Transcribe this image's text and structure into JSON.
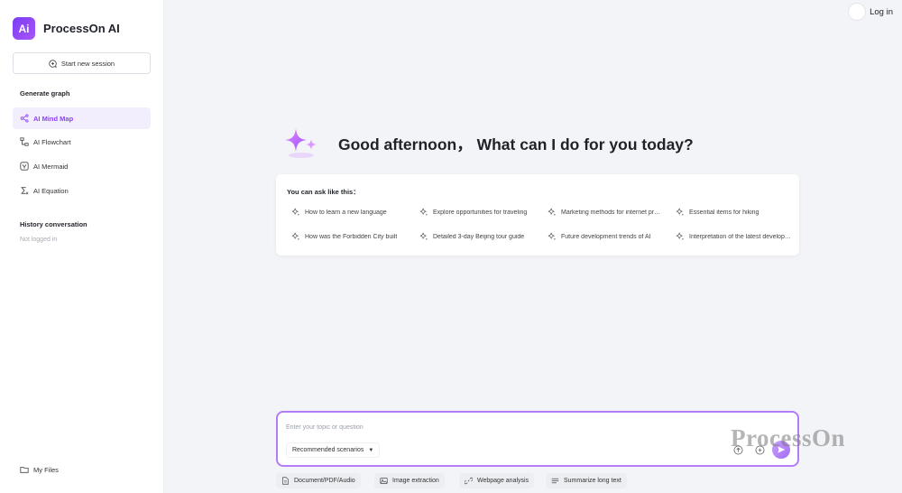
{
  "brand": {
    "name": "ProcessOn AI",
    "logo_text": "Ai",
    "accent": "#8a3ffc"
  },
  "sidebar": {
    "new_session": "Start new session",
    "generate_title": "Generate graph",
    "items": [
      {
        "label": "AI Mind Map",
        "icon": "mindmap-icon",
        "active": true
      },
      {
        "label": "AI Flowchart",
        "icon": "flowchart-icon",
        "active": false
      },
      {
        "label": "AI Mermaid",
        "icon": "mermaid-icon",
        "active": false
      },
      {
        "label": "AI Equation",
        "icon": "sigma-icon",
        "active": false
      }
    ],
    "history_title": "History conversation",
    "history_status": "Not logged in",
    "my_files": "My Files"
  },
  "header": {
    "login": "Log in"
  },
  "hero": {
    "greeting": "Good afternoon， What can I do for you today?"
  },
  "suggestions": {
    "title": "You can ask like this：",
    "items": [
      "How to learn a new language",
      "Explore opportunities for traveling",
      "Marketing methods for internet products",
      "Essential items for hiking",
      "How was the Forbidden City built",
      "Detailed 3-day Beijing tour guide",
      "Future development trends of AI",
      "Interpretation of the latest development"
    ]
  },
  "composer": {
    "placeholder": "Enter your topic or question",
    "scenario": "Recommended scenarios",
    "watermark": "ProcessOn"
  },
  "quick_actions": [
    {
      "label": "Document/PDF/Audio",
      "icon": "document-icon"
    },
    {
      "label": "Image extraction",
      "icon": "image-icon"
    },
    {
      "label": "Webpage analysis",
      "icon": "link-icon"
    },
    {
      "label": "Summarize long text",
      "icon": "list-icon"
    }
  ]
}
